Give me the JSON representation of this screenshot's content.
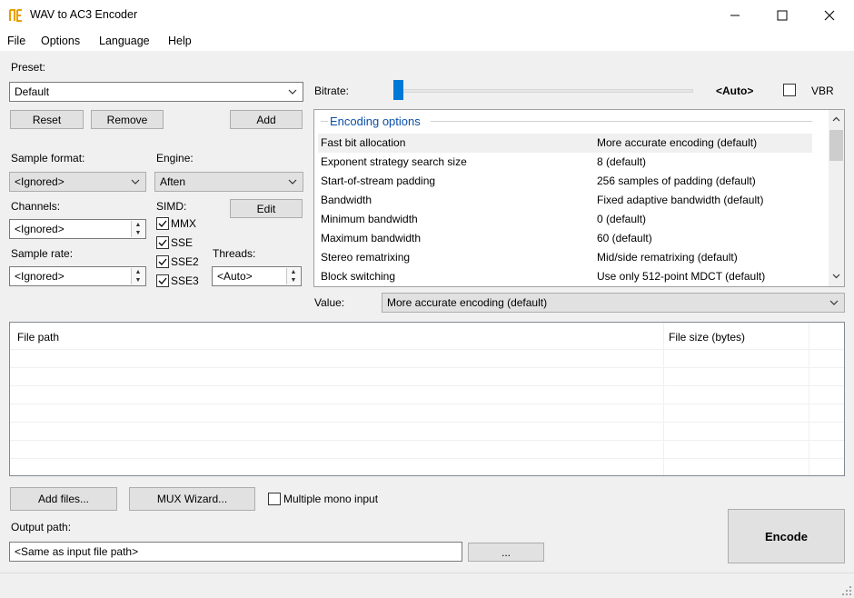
{
  "window": {
    "title": "WAV to AC3 Encoder"
  },
  "menu": [
    "File",
    "Options",
    "Language",
    "Help"
  ],
  "preset": {
    "label": "Preset:",
    "value": "Default",
    "reset": "Reset",
    "remove": "Remove",
    "add": "Add"
  },
  "bitrate": {
    "label": "Bitrate:",
    "value_text": "<Auto>",
    "level": 0,
    "vbr_label": "VBR",
    "vbr_checked": false
  },
  "sample_format": {
    "label": "Sample format:",
    "value": "<Ignored>"
  },
  "engine": {
    "label": "Engine:",
    "value": "Aften",
    "edit": "Edit"
  },
  "channels": {
    "label": "Channels:",
    "value": "<Ignored>"
  },
  "sample_rate": {
    "label": "Sample rate:",
    "value": "<Ignored>"
  },
  "simd": {
    "label": "SIMD:",
    "options": [
      {
        "label": "MMX",
        "checked": true
      },
      {
        "label": "SSE",
        "checked": true
      },
      {
        "label": "SSE2",
        "checked": true
      },
      {
        "label": "SSE3",
        "checked": true
      }
    ]
  },
  "threads": {
    "label": "Threads:",
    "value": "<Auto>"
  },
  "encoding_options": {
    "group_title": "Encoding options",
    "rows": [
      {
        "name": "Fast bit allocation",
        "value": "More accurate encoding (default)"
      },
      {
        "name": "Exponent strategy search size",
        "value": "8 (default)"
      },
      {
        "name": "Start-of-stream padding",
        "value": "256 samples of padding (default)"
      },
      {
        "name": "Bandwidth",
        "value": "Fixed adaptive bandwidth (default)"
      },
      {
        "name": "Minimum bandwidth",
        "value": "0 (default)"
      },
      {
        "name": "Maximum bandwidth",
        "value": "60 (default)"
      },
      {
        "name": "Stereo rematrixing",
        "value": "Mid/side rematrixing (default)"
      },
      {
        "name": "Block switching",
        "value": "Use only 512-point MDCT (default)"
      }
    ]
  },
  "value_field": {
    "label": "Value:",
    "value": "More accurate encoding (default)"
  },
  "file_list": {
    "col_path": "File path",
    "col_size": "File size (bytes)"
  },
  "actions": {
    "add_files": "Add files...",
    "mux_wizard": "MUX Wizard...",
    "multiple_mono": "Multiple mono input",
    "multiple_mono_checked": false
  },
  "output": {
    "label": "Output path:",
    "value": "<Same as input file path>",
    "browse": "..."
  },
  "encode": "Encode",
  "colors": {
    "accent": "#0078d7",
    "group_title": "#0b50a8"
  }
}
